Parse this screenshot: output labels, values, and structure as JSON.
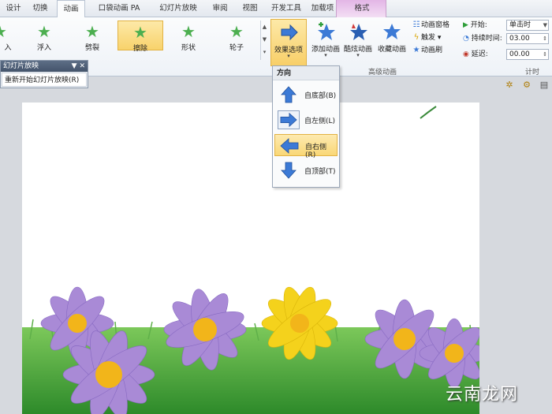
{
  "tabs": [
    "设计",
    "切换",
    "动画",
    "口袋动画 PA",
    "幻灯片放映",
    "审阅",
    "视图",
    "开发工具",
    "加载项",
    "格式"
  ],
  "gallery": [
    {
      "label": "入",
      "icon": "star-icon"
    },
    {
      "label": "浮入",
      "icon": "star-icon"
    },
    {
      "label": "劈裂",
      "icon": "star-icon"
    },
    {
      "label": "擦除",
      "icon": "star-icon",
      "selected": true
    },
    {
      "label": "形状",
      "icon": "star-icon"
    },
    {
      "label": "轮子",
      "icon": "star-icon"
    }
  ],
  "effect_options": {
    "label": "效果选项"
  },
  "add_animation": {
    "label": "添加动画"
  },
  "cool_animation": {
    "label": "酷炫动画"
  },
  "favorite_animation": {
    "label": "收藏动画"
  },
  "small_commands": {
    "animation_pane": "动画窗格",
    "trigger": "触发",
    "animation_painter": "动画刷"
  },
  "group_labels": {
    "advanced": "高级动画",
    "timing": "计时"
  },
  "timing": {
    "start_label": "开始:",
    "start_value": "单击时",
    "duration_label": "持续时间:",
    "duration_value": "03.00",
    "delay_label": "延迟:",
    "delay_value": "00.00"
  },
  "left_pane": {
    "title": "幻灯片放映",
    "item": "重新开始幻灯片放映(R)"
  },
  "dropdown": {
    "header": "方向",
    "options": [
      {
        "label": "自底部(B)",
        "direction": "up"
      },
      {
        "label": "自左侧(L)",
        "direction": "right"
      },
      {
        "label": "自右侧(R)",
        "direction": "left",
        "selected": true
      },
      {
        "label": "自顶部(T)",
        "direction": "down"
      }
    ]
  },
  "watermark": "云南龙网",
  "colors": {
    "accent": "#f8d26b",
    "context_tab": "#e3b5e6",
    "arrow_blue": "#3c7ad6"
  }
}
